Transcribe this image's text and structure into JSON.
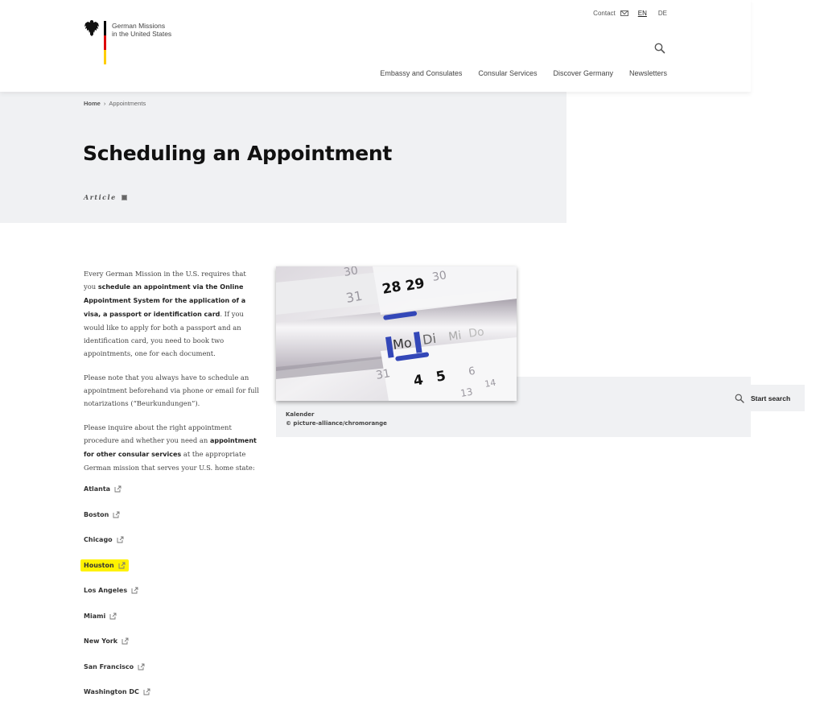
{
  "header": {
    "logo_line1": "German Missions",
    "logo_line2": "in the United States",
    "meta_nav": {
      "contact": "Contact",
      "contact_icon": "mail-icon",
      "lang_en": "EN",
      "lang_de": "DE"
    },
    "search_icon": "search-icon",
    "main_nav": [
      {
        "label": "Embassy and Consulates"
      },
      {
        "label": "Consular Services"
      },
      {
        "label": "Discover Germany"
      },
      {
        "label": "Newsletters"
      }
    ]
  },
  "hero": {
    "breadcrumb": {
      "home": "Home",
      "separator": "›",
      "current": "Appointments"
    },
    "title": "Scheduling an Appointment",
    "doc_type": "Article"
  },
  "article": {
    "p1": {
      "t1": "Every German Mission in the U.S. requires that you ",
      "b1": "schedule an appointment via the Online Appointment System for the application of a visa, a passport or identification card",
      "t2": ". If you would like to apply for both a passport and an identification card, you need to book two appointments, one for each document."
    },
    "p2": "Please note that you always have to schedule an appointment beforehand via phone or email for full notarizations (“Beurkundungen”).",
    "p3": {
      "t1": "Please inquire about the right appointment procedure and whether you need an ",
      "b1": "appointment for other consular services",
      "t2": " at the appropriate German mission that  serves your U.S. home state:"
    }
  },
  "figure": {
    "alt": "Calendar with Mo Di days",
    "caption_title": "Kalender",
    "caption_credit": "© picture-alliance/chromorange"
  },
  "start_search": {
    "label": "Start search"
  },
  "links": [
    {
      "label": "Atlanta",
      "highlighted": false
    },
    {
      "label": "Boston",
      "highlighted": false
    },
    {
      "label": "Chicago",
      "highlighted": false
    },
    {
      "label": "Houston",
      "highlighted": true
    },
    {
      "label": "Los Angeles",
      "highlighted": false
    },
    {
      "label": "Miami",
      "highlighted": false
    },
    {
      "label": "New York",
      "highlighted": false
    },
    {
      "label": "San Francisco",
      "highlighted": false
    },
    {
      "label": "Washington DC",
      "highlighted": false
    }
  ],
  "colors": {
    "hero_bg": "#f0f1f3",
    "highlight": "#fff200",
    "flag_black": "#000000",
    "flag_red": "#dd0000",
    "flag_gold": "#ffce00"
  }
}
